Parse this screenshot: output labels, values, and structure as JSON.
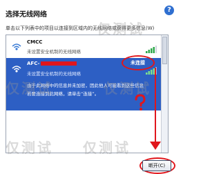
{
  "window": {
    "title": "选择无线网络",
    "help_glyph": "?",
    "instruction": "单击以下列表中的项目以连接到区域内的无线网络或获得更多信息(W)"
  },
  "networks": [
    {
      "ssid": "CMCC",
      "description": "未设置安全机制的无线网络",
      "status": ""
    },
    {
      "ssid": "AFC-",
      "ssid_redacted": true,
      "description_line1": "未设置安全机制的无线网络",
      "description_line2": "由于此网络中的信息并未加密，因此他人可能看到这些信息",
      "description_line3": "若要连接到此网络，请单击“连接”。",
      "status": "未连接"
    }
  ],
  "buttons": {
    "connect": "断开(C)"
  },
  "watermark": "仅测试",
  "colors": {
    "selection": "#2d5fc4",
    "annotation": "#e0161c",
    "help": "#2f6fd0"
  }
}
